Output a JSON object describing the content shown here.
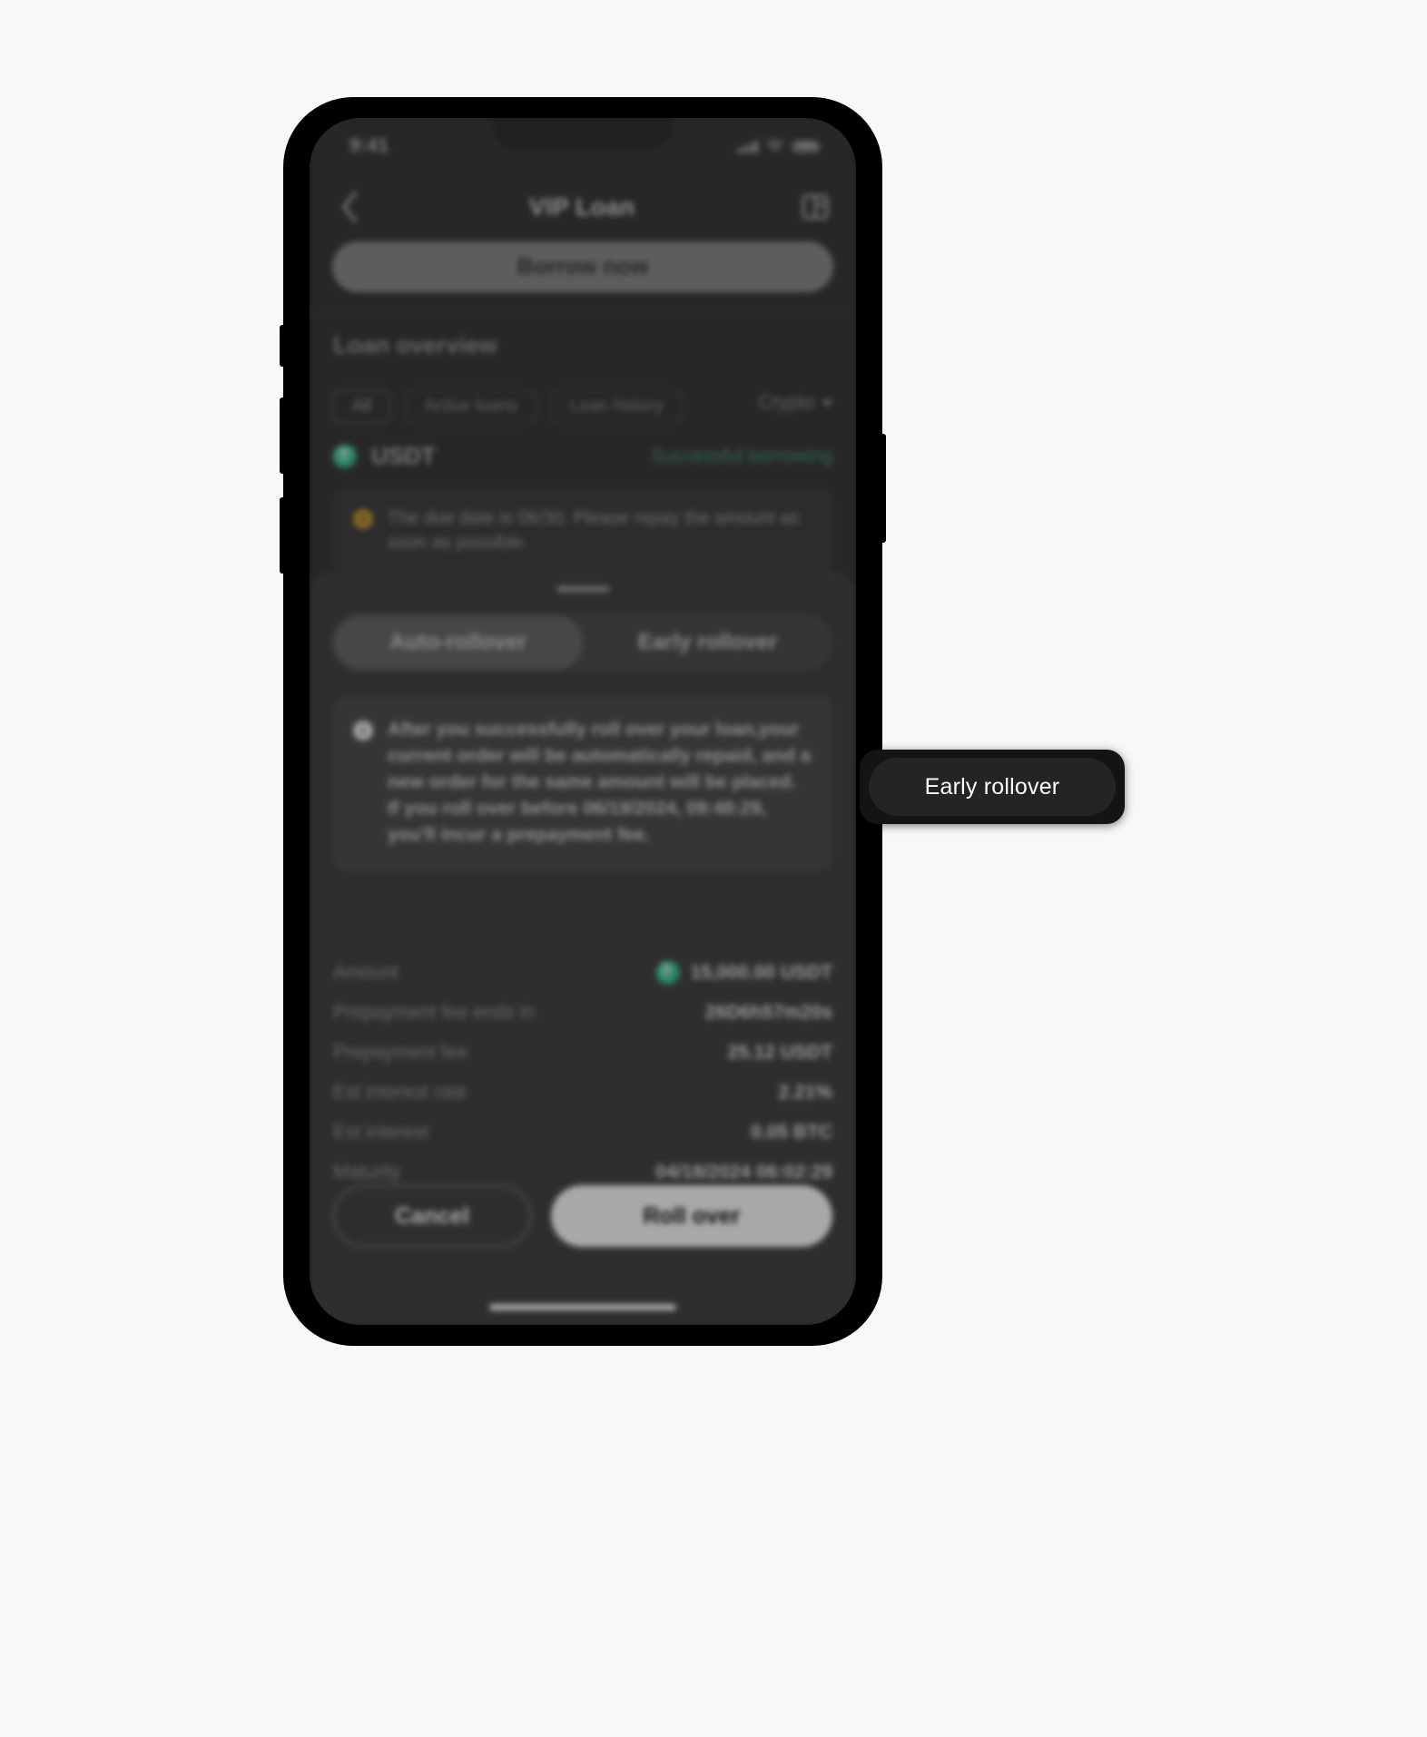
{
  "status_bar": {
    "time": "9:41",
    "signal_icon": "cellular-bars-icon",
    "wifi_icon": "wifi-icon",
    "battery_icon": "battery-icon"
  },
  "nav": {
    "back_icon": "chevron-left-icon",
    "title": "VIP Loan",
    "doc_icon": "document-book-icon"
  },
  "primary_action": {
    "borrow_label": "Borrow now"
  },
  "loan_overview": {
    "title": "Loan overview",
    "chips": [
      {
        "label": "All",
        "selected": true
      },
      {
        "label": "Active loans",
        "selected": false
      },
      {
        "label": "Loan history",
        "selected": false
      }
    ],
    "filter": {
      "label": "Crypto",
      "caret_icon": "chevron-down-icon"
    },
    "asset": {
      "icon": "usdt-coin-icon",
      "symbol": "USDT",
      "status": "Successful borrowing"
    },
    "warning": {
      "icon": "warning-circle-icon",
      "text": "The due date is 06/30. Please repay the amount as soon as possible."
    }
  },
  "sheet": {
    "grabber": "drag-handle",
    "tabs": [
      {
        "label": "Auto-rollover",
        "selected": false
      },
      {
        "label": "Early rollover",
        "selected": true
      }
    ],
    "info": {
      "icon": "info-circle-icon",
      "text": "After you successfully roll over your loan,your current order will be automatically repaid, and a new order for the same amount will be placed. If you roll over before 06/19/2024, 09:48:29, you'll incur a prepayment fee."
    },
    "details": [
      {
        "label": "Amount",
        "value": "15,000.00 USDT",
        "icon": "usdt-coin-icon"
      },
      {
        "label": "Prepayment fee ends in",
        "value": "26D6h57m20s",
        "icon": null
      },
      {
        "label": "Prepayment fee",
        "value": "25.12 USDT",
        "icon": null
      },
      {
        "label": "Est interest rate",
        "value": "2.21%",
        "icon": null
      },
      {
        "label": "Est interest",
        "value": "0.05 BTC",
        "icon": null
      },
      {
        "label": "Maturity",
        "value": "04/18/2024 06:02:29",
        "icon": null
      }
    ],
    "footer": {
      "cancel_label": "Cancel",
      "confirm_label": "Roll over"
    }
  },
  "highlight": {
    "label": "Early rollover"
  },
  "colors": {
    "accent_usdt": "#3ec9a0",
    "success_text": "#4e9d7d",
    "warning": "#c9a032",
    "sheet_bg": "#474747",
    "confirm_bg": "#ffffff",
    "highlight_bg": "#141414"
  }
}
